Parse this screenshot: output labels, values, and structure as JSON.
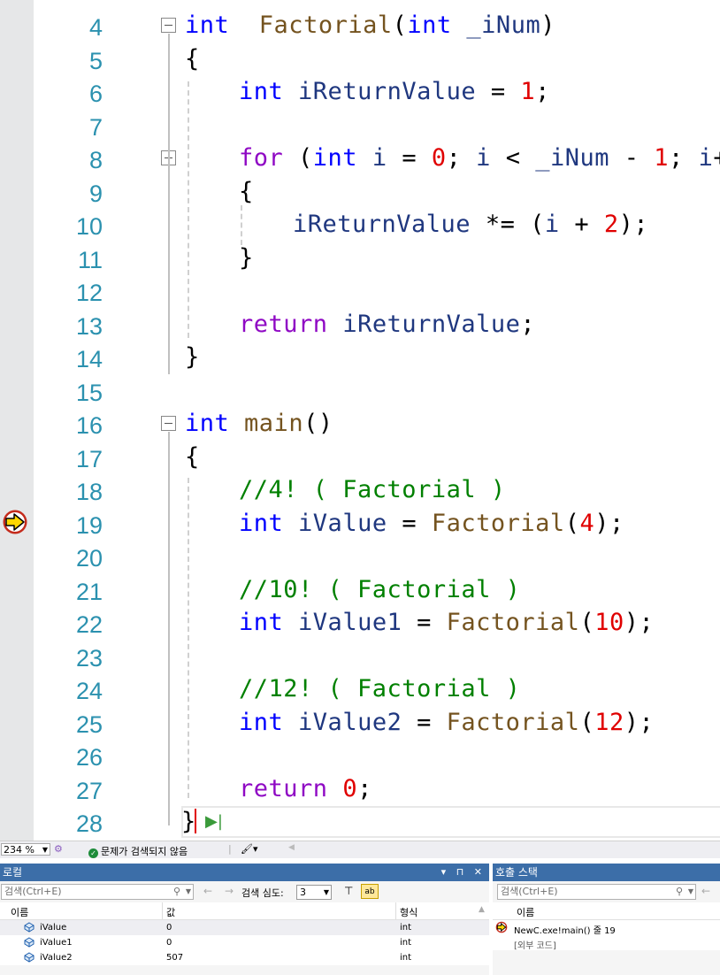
{
  "editor": {
    "lines": [
      {
        "n": "4",
        "tokens": [
          [
            "kw",
            "int"
          ],
          [
            "",
            "  "
          ],
          [
            "fn",
            "Factorial"
          ],
          [
            "",
            "("
          ],
          [
            "kw",
            "int"
          ],
          [
            "",
            " "
          ],
          [
            "var",
            "_iNum"
          ],
          [
            "",
            ")"
          ]
        ],
        "indent": 209
      },
      {
        "n": "5",
        "tokens": [
          [
            "",
            "{"
          ]
        ],
        "indent": 209
      },
      {
        "n": "6",
        "tokens": [
          [
            "kw",
            "int"
          ],
          [
            "",
            " "
          ],
          [
            "var",
            "iReturnValue"
          ],
          [
            "",
            " = "
          ],
          [
            "num",
            "1"
          ],
          [
            "",
            ";"
          ]
        ],
        "indent": 270
      },
      {
        "n": "7",
        "tokens": [],
        "indent": 270
      },
      {
        "n": "8",
        "tokens": [
          [
            "kw2",
            "for"
          ],
          [
            "",
            " ("
          ],
          [
            "kw",
            "int"
          ],
          [
            "",
            " "
          ],
          [
            "var",
            "i"
          ],
          [
            "",
            " = "
          ],
          [
            "num",
            "0"
          ],
          [
            "",
            "; "
          ],
          [
            "var",
            "i"
          ],
          [
            "",
            " < "
          ],
          [
            "var",
            "_iNum"
          ],
          [
            "",
            " - "
          ],
          [
            "num",
            "1"
          ],
          [
            "",
            "; "
          ],
          [
            "var",
            "i"
          ],
          [
            "",
            "++)"
          ]
        ],
        "indent": 270
      },
      {
        "n": "9",
        "tokens": [
          [
            "",
            "{"
          ]
        ],
        "indent": 270
      },
      {
        "n": "10",
        "tokens": [
          [
            "var",
            "iReturnValue"
          ],
          [
            "",
            " *= ("
          ],
          [
            "var",
            "i"
          ],
          [
            "",
            " + "
          ],
          [
            "num",
            "2"
          ],
          [
            "",
            ");"
          ]
        ],
        "indent": 331
      },
      {
        "n": "11",
        "tokens": [
          [
            "",
            "}"
          ]
        ],
        "indent": 270
      },
      {
        "n": "12",
        "tokens": [],
        "indent": 270
      },
      {
        "n": "13",
        "tokens": [
          [
            "kw2",
            "return"
          ],
          [
            "",
            " "
          ],
          [
            "var",
            "iReturnValue"
          ],
          [
            "",
            ";"
          ]
        ],
        "indent": 270
      },
      {
        "n": "14",
        "tokens": [
          [
            "",
            "}"
          ]
        ],
        "indent": 209
      },
      {
        "n": "15",
        "tokens": [],
        "indent": 209
      },
      {
        "n": "16",
        "tokens": [
          [
            "kw",
            "int"
          ],
          [
            "",
            " "
          ],
          [
            "fn",
            "main"
          ],
          [
            "",
            "()"
          ]
        ],
        "indent": 209
      },
      {
        "n": "17",
        "tokens": [
          [
            "",
            "{"
          ]
        ],
        "indent": 209
      },
      {
        "n": "18",
        "tokens": [
          [
            "cm",
            "//4! ( Factorial )"
          ]
        ],
        "indent": 270
      },
      {
        "n": "19",
        "tokens": [
          [
            "kw",
            "int"
          ],
          [
            "",
            " "
          ],
          [
            "var",
            "iValue"
          ],
          [
            "",
            " = "
          ],
          [
            "fn",
            "Factorial"
          ],
          [
            "",
            "("
          ],
          [
            "num",
            "4"
          ],
          [
            "",
            ");"
          ]
        ],
        "indent": 270
      },
      {
        "n": "20",
        "tokens": [],
        "indent": 270
      },
      {
        "n": "21",
        "tokens": [
          [
            "cm",
            "//10! ( Factorial )"
          ]
        ],
        "indent": 270
      },
      {
        "n": "22",
        "tokens": [
          [
            "kw",
            "int"
          ],
          [
            "",
            " "
          ],
          [
            "var",
            "iValue1"
          ],
          [
            "",
            " = "
          ],
          [
            "fn",
            "Factorial"
          ],
          [
            "",
            "("
          ],
          [
            "num",
            "10"
          ],
          [
            "",
            ");"
          ]
        ],
        "indent": 270
      },
      {
        "n": "23",
        "tokens": [],
        "indent": 270
      },
      {
        "n": "24",
        "tokens": [
          [
            "cm",
            "//12! ( Factorial )"
          ]
        ],
        "indent": 270
      },
      {
        "n": "25",
        "tokens": [
          [
            "kw",
            "int"
          ],
          [
            "",
            " "
          ],
          [
            "var",
            "iValue2"
          ],
          [
            "",
            " = "
          ],
          [
            "fn",
            "Factorial"
          ],
          [
            "",
            "("
          ],
          [
            "num",
            "12"
          ],
          [
            "",
            ");"
          ]
        ],
        "indent": 270
      },
      {
        "n": "26",
        "tokens": [],
        "indent": 270
      },
      {
        "n": "27",
        "tokens": [
          [
            "kw2",
            "return"
          ],
          [
            "",
            " "
          ],
          [
            "num",
            "0"
          ],
          [
            "",
            ";"
          ]
        ],
        "indent": 270
      },
      {
        "n": "28",
        "tokens": [
          [
            "",
            "}"
          ]
        ],
        "indent": 205
      }
    ]
  },
  "statusbar": {
    "zoom": "234 %",
    "issues": "문제가 검색되지 않음"
  },
  "locals": {
    "title": "로컬",
    "search_placeholder": "검색(Ctrl+E)",
    "depth_label": "검색 심도:",
    "depth_value": "3",
    "col_name": "이름",
    "col_value": "값",
    "col_type": "형식",
    "rows": [
      {
        "name": "iValue",
        "value": "0",
        "type": "int"
      },
      {
        "name": "iValue1",
        "value": "0",
        "type": "int"
      },
      {
        "name": "iValue2",
        "value": "507",
        "type": "int"
      }
    ]
  },
  "callstack": {
    "title": "호출 스택",
    "search_placeholder": "검색(Ctrl+E)",
    "col_name": "이름",
    "frames": [
      {
        "name": "NewC.exe!main() 줄 19"
      },
      {
        "name": "[외부 코드]"
      }
    ]
  },
  "colors": {
    "pane_header": "#3c6ea8",
    "breakpoint_arrow": "#ffd700",
    "breakpoint_ring": "#c42b1c"
  }
}
